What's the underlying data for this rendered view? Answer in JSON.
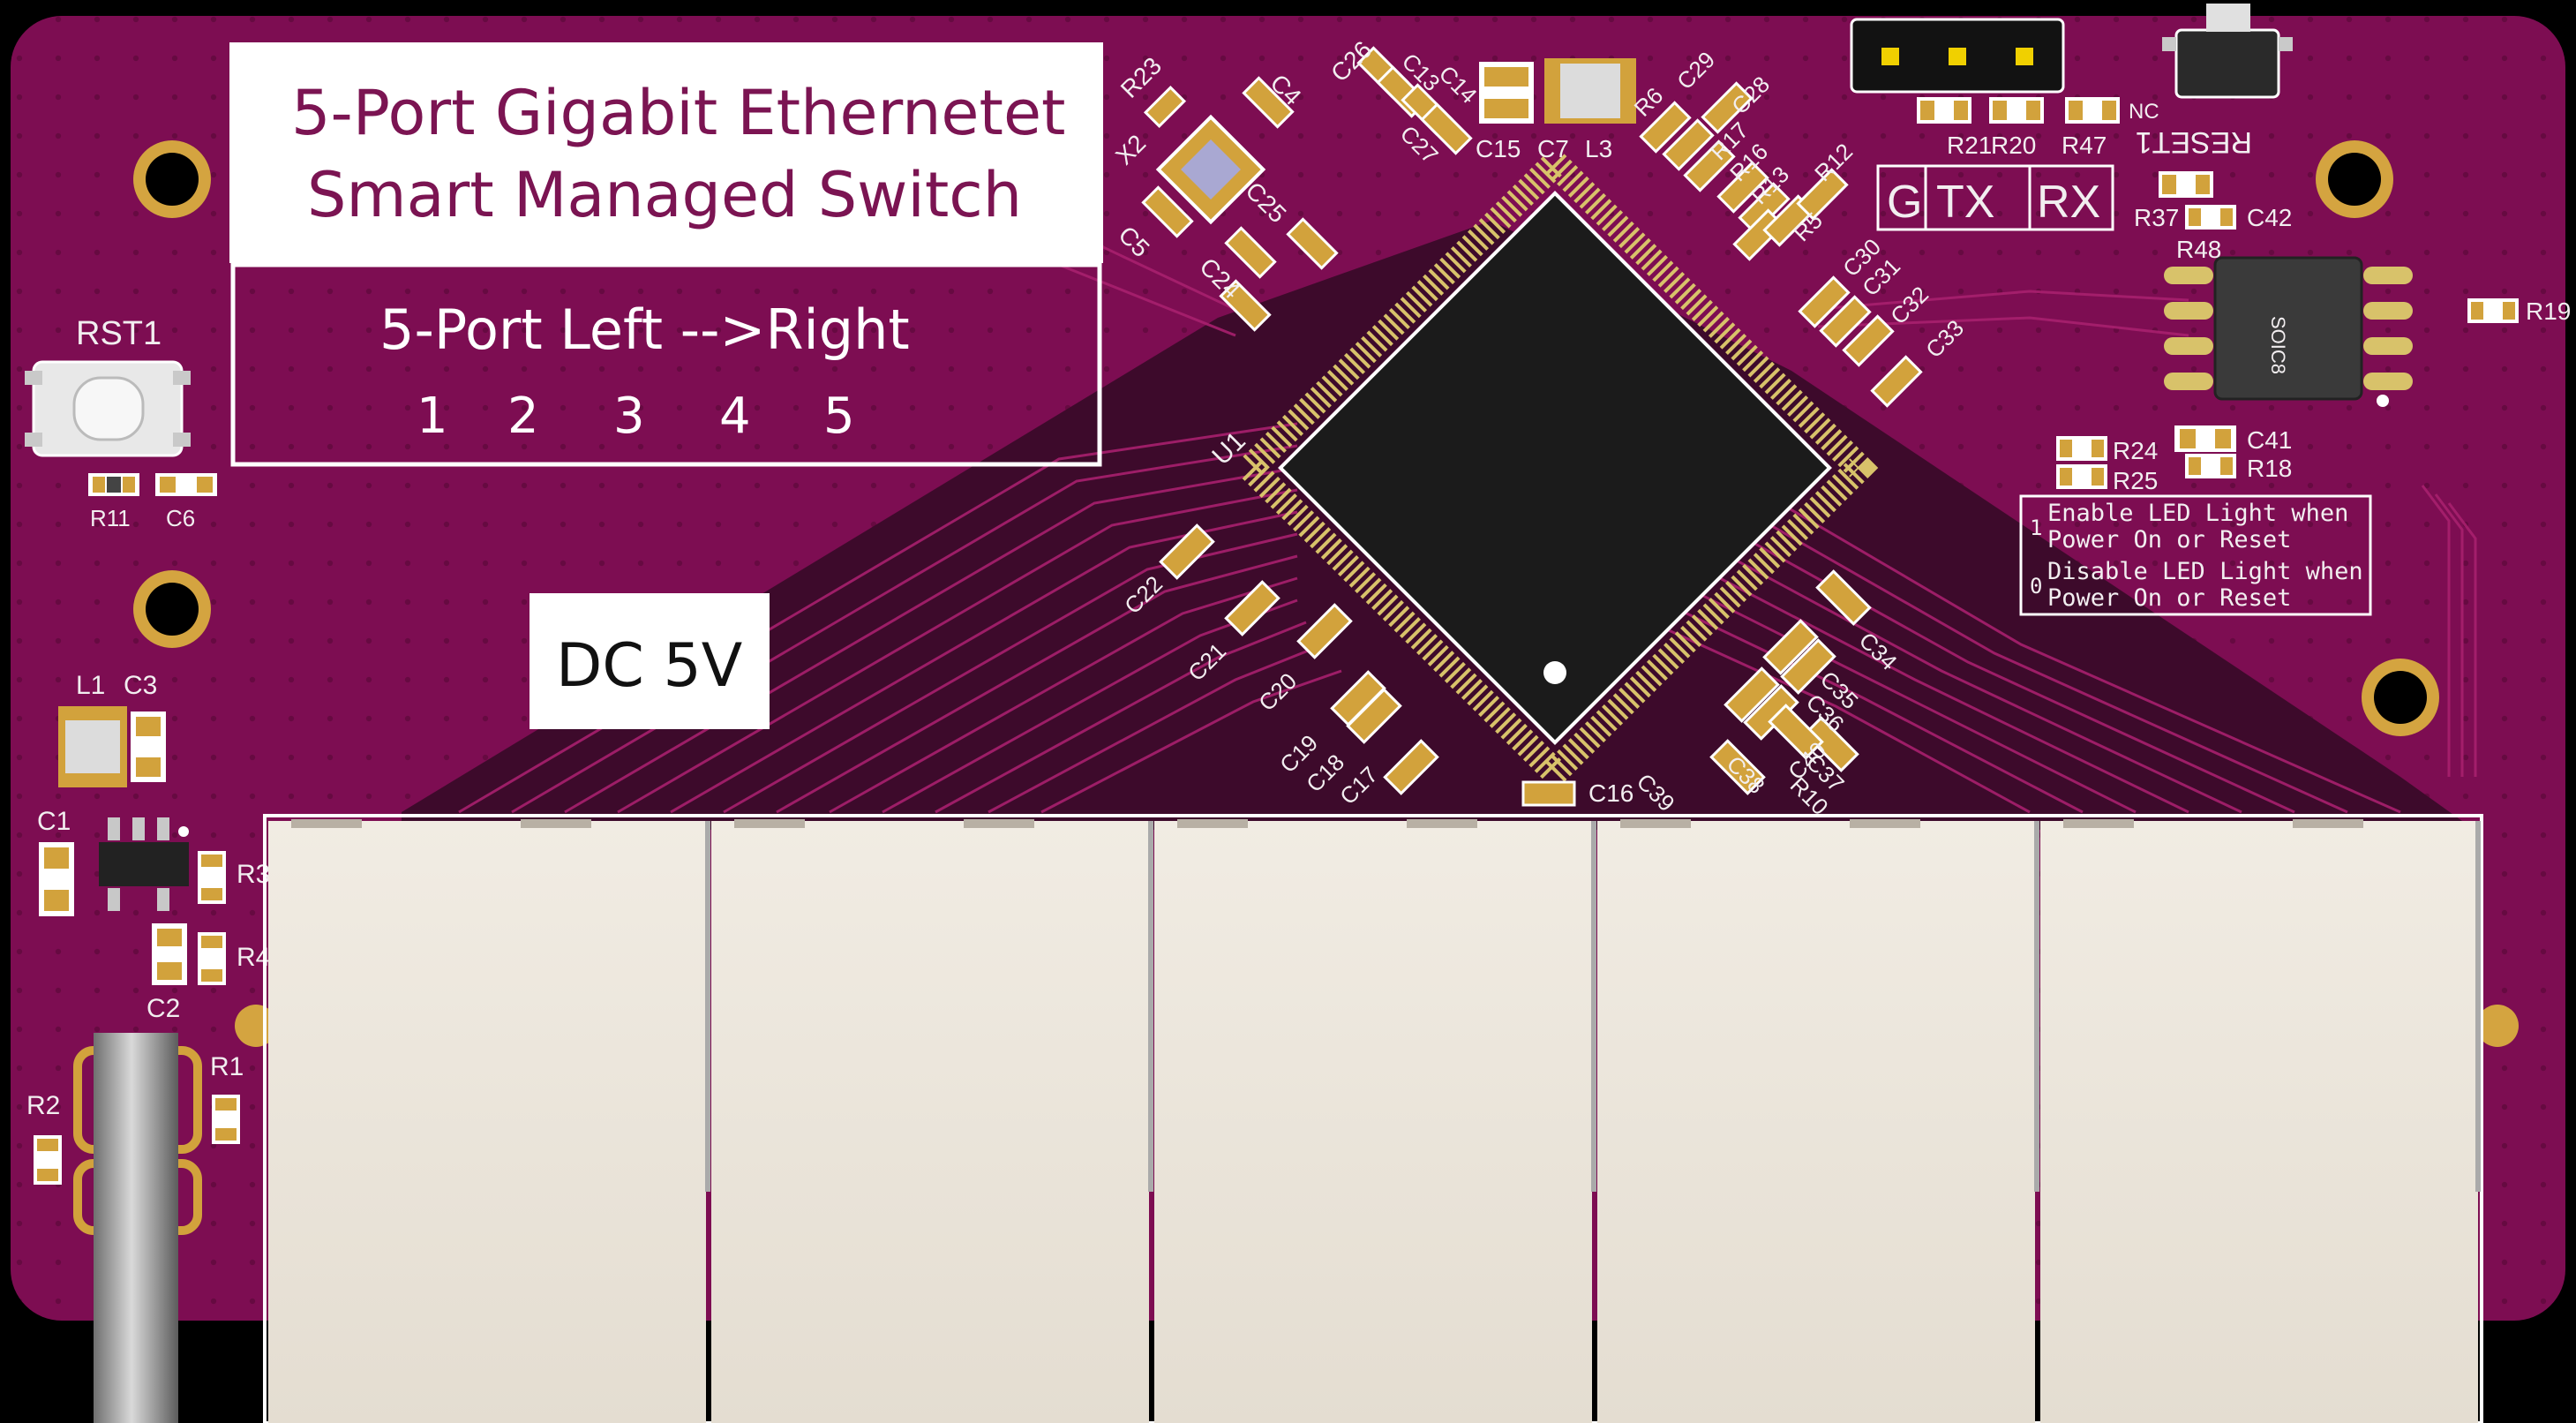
{
  "board": {
    "title_line1": "5-Port Gigabit Ethernetet",
    "title_line2": "Smart Managed Switch",
    "port_direction": "5-Port Left -->Right",
    "port_numbers": [
      "1",
      "2",
      "3",
      "4",
      "5"
    ],
    "power_label": "DC 5V",
    "switch_label": "RST1",
    "chip_label": "U1",
    "eeprom_label": "SOIC8",
    "reset_label": "RESET1",
    "uart_labels": [
      "G",
      "TX",
      "RX"
    ],
    "jumper_note": {
      "opt1": "1",
      "line1a": "Enable LED Light when",
      "line1b": "Power On or Reset",
      "opt0": "0",
      "line2a": "Disable LED Light when",
      "line2b": "Power On or Reset"
    },
    "designators": [
      "R11",
      "C6",
      "L1",
      "C3",
      "C1",
      "R3",
      "R4",
      "C2",
      "R2",
      "R1",
      "R23",
      "X2",
      "C4",
      "C5",
      "C24",
      "C25",
      "C26",
      "C13",
      "C14",
      "C27",
      "C15",
      "C7",
      "L3",
      "R6",
      "C29",
      "C28",
      "R17",
      "R16",
      "R13",
      "R12",
      "R5",
      "C30",
      "C31",
      "C32",
      "C33",
      "R21",
      "R20",
      "R47",
      "NC",
      "R37",
      "C42",
      "R48",
      "R19",
      "R24",
      "R25",
      "C41",
      "R18",
      "C22",
      "C21",
      "C20",
      "C19",
      "C18",
      "C17",
      "C16",
      "C39",
      "C38",
      "C40",
      "C37",
      "R10",
      "C36",
      "C35",
      "C34"
    ]
  },
  "colors": {
    "pcb": "#7d0d52",
    "pcb_dark": "#3b0a2a",
    "gold": "#d2a23c",
    "silkscreen": "#f2eef0",
    "rj45": "#ece6dc",
    "chip": "#1b1b1b"
  }
}
